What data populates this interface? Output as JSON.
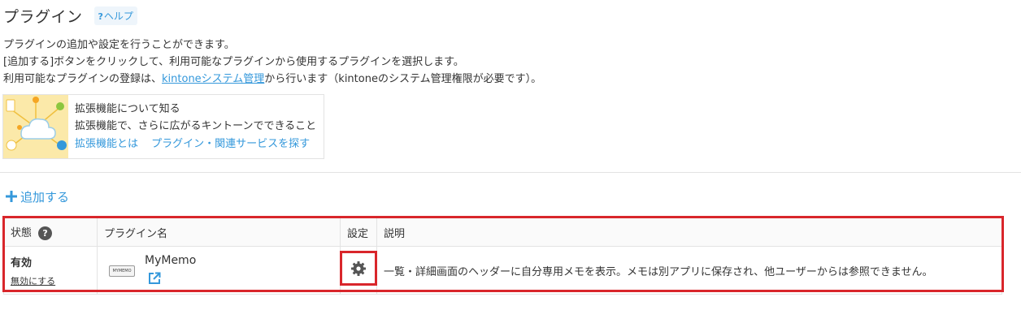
{
  "header": {
    "title": "プラグイン",
    "help_label": "ヘルプ",
    "help_q": "?"
  },
  "description": {
    "line1": "プラグインの追加や設定を行うことができます。",
    "line2": "[追加する]ボタンをクリックして、利用可能なプラグインから使用するプラグインを選択します。",
    "line3_before": "利用可能なプラグインの登録は、",
    "line3_link": "kintoneシステム管理",
    "line3_after": "から行います（kintoneのシステム管理権限が必要です）。"
  },
  "promo": {
    "title": "拡張機能について知る",
    "text": "拡張機能で、さらに広がるキントーンでできること",
    "link1": "拡張機能とは",
    "link2": "プラグイン・関連サービスを探す"
  },
  "toolbar": {
    "add_label": "追加する",
    "add_icon": "plus-icon"
  },
  "table": {
    "headers": {
      "status": "状態",
      "status_help": "?",
      "name": "プラグイン名",
      "settings": "設定",
      "description": "説明"
    },
    "rows": [
      {
        "status": "有効",
        "disable_label": "無効にする",
        "logo_text": "MYMEMO",
        "name": "MyMemo",
        "description": "一覧・詳細画面のヘッダーに自分専用メモを表示。メモは別アプリに保存され、他ユーザーからは参照できません。"
      }
    ]
  },
  "colors": {
    "accent": "#3498db",
    "highlight": "#d9262b",
    "gear": "#555555"
  }
}
